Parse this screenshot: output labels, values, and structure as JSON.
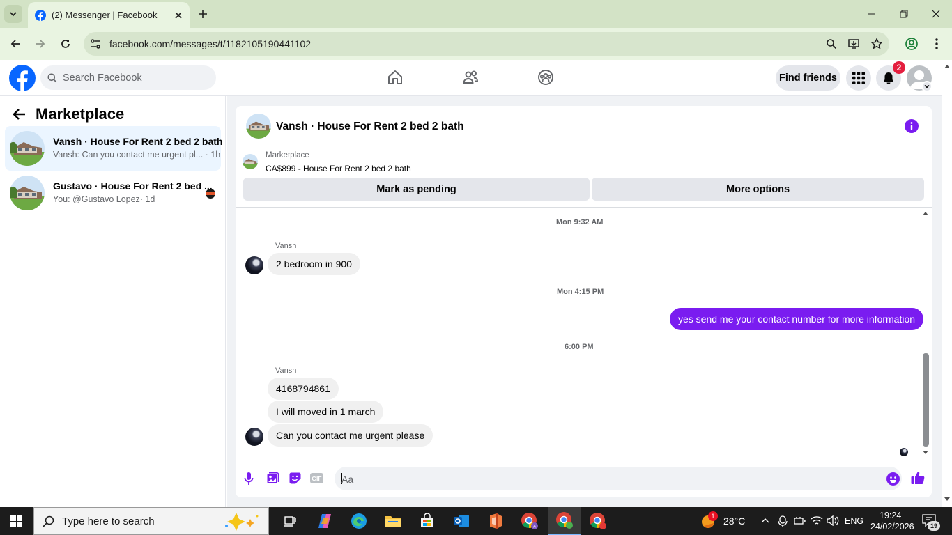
{
  "browser": {
    "tab_title": "(2) Messenger | Facebook",
    "url": "facebook.com/messages/t/1182105190441102"
  },
  "facebook": {
    "search_placeholder": "Search Facebook",
    "find_friends": "Find friends",
    "notification_count": "2",
    "brand_color": "#0866ff"
  },
  "sidebar": {
    "title": "Marketplace",
    "conversations": [
      {
        "name": "Vansh · House For Rent 2 bed 2 bath",
        "preview": "Vansh: Can you contact me urgent pl...",
        "time": "· 1h",
        "active": true
      },
      {
        "name": "Gustavo · House For Rent 2 bed ...",
        "preview": "You: @Gustavo Lopez",
        "time": "· 1d",
        "active": false
      }
    ]
  },
  "chat": {
    "title": "Vansh · House For Rent 2 bed 2 bath",
    "listing_source": "Marketplace",
    "listing_price_title": "CA$899 - House For Rent 2 bed 2 bath",
    "mark_pending": "Mark as pending",
    "more_options": "More options",
    "accent_color": "#7a1cf0",
    "messages": [
      {
        "timestamp": "Mon 9:32 AM"
      },
      {
        "sender": "Vansh",
        "text": "2 bedroom in 900"
      },
      {
        "timestamp": "Mon 4:15 PM"
      },
      {
        "sender": "me",
        "text": "yes send me your contact number for more information"
      },
      {
        "timestamp": "6:00 PM"
      },
      {
        "sender": "Vansh",
        "text": "4168794861"
      },
      {
        "sender": "Vansh",
        "text": "I will moved in 1 march"
      },
      {
        "sender": "Vansh",
        "text": "Can you contact me urgent please"
      }
    ],
    "composer_placeholder": "Aa"
  },
  "taskbar": {
    "search_placeholder": "Type here to search",
    "weather": "28°C",
    "language": "ENG",
    "time": "19:24",
    "date": "24/02/2026",
    "notification_count": "19",
    "weather_alert": "1"
  }
}
